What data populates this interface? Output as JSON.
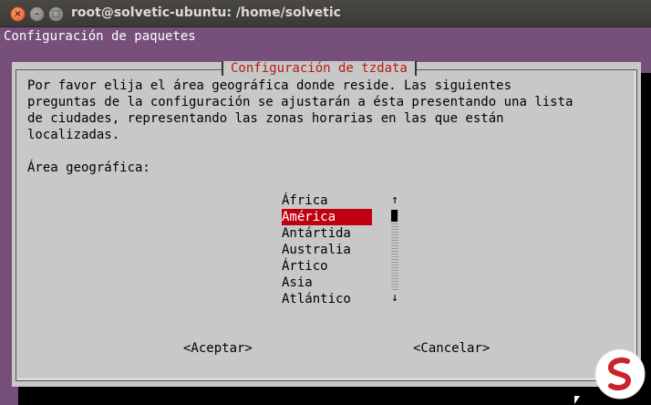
{
  "window": {
    "title": "root@solvetic-ubuntu: /home/solvetic"
  },
  "terminal": {
    "heading": "Configuración de paquetes"
  },
  "dialog": {
    "title": "Configuración de tzdata",
    "description": "Por favor elija el área geográfica donde reside. Las siguientes\npreguntas de la configuración se ajustarán a ésta presentando una lista\nde ciudades, representando las zonas horarias en las que están\nlocalizadas.",
    "area_label": "Área geográfica:",
    "options": [
      "África",
      "América",
      "Antártida",
      "Australia",
      "Ártico",
      "Asia",
      "Atlántico"
    ],
    "selected": "América",
    "ok_label": "<Aceptar>",
    "cancel_label": "<Cancelar>",
    "scroll_up": "↑",
    "scroll_down": "↓"
  }
}
